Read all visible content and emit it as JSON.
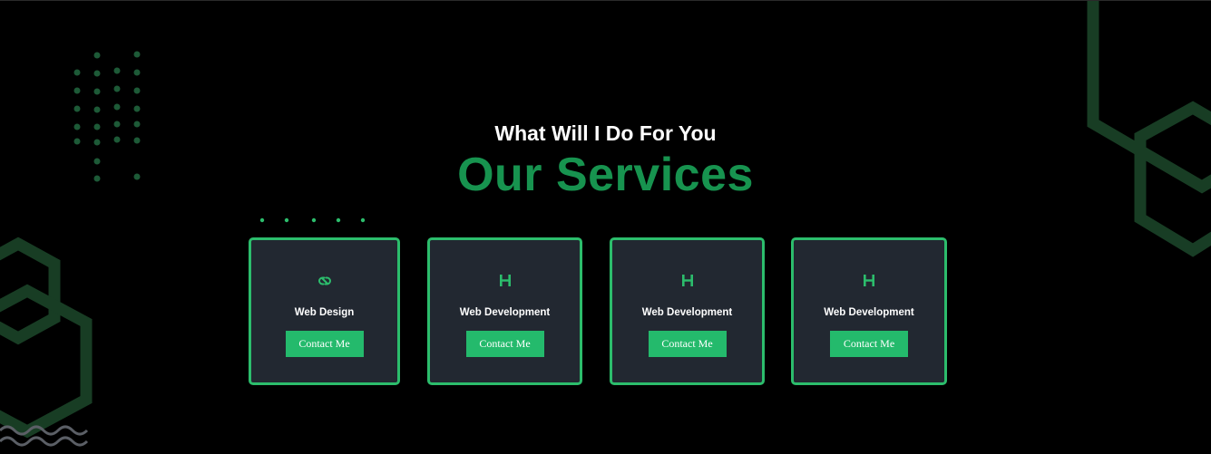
{
  "section": {
    "subheading": "What Will I Do For You",
    "heading": "Our Services"
  },
  "services": [
    {
      "title": "Web Design",
      "icon": "link-icon",
      "button": "Contact Me"
    },
    {
      "title": "Web Development",
      "icon": "h-letter-icon",
      "button": "Contact Me"
    },
    {
      "title": "Web Development",
      "icon": "h-letter-icon",
      "button": "Contact Me"
    },
    {
      "title": "Web Development",
      "icon": "h-letter-icon",
      "button": "Contact Me"
    }
  ],
  "colors": {
    "background": "#000000",
    "accent_green": "#17934f",
    "button_green": "#24ba6c",
    "card_bg": "#222831",
    "card_border": "#2cbd6c",
    "decor_green": "#1f4a2f"
  }
}
